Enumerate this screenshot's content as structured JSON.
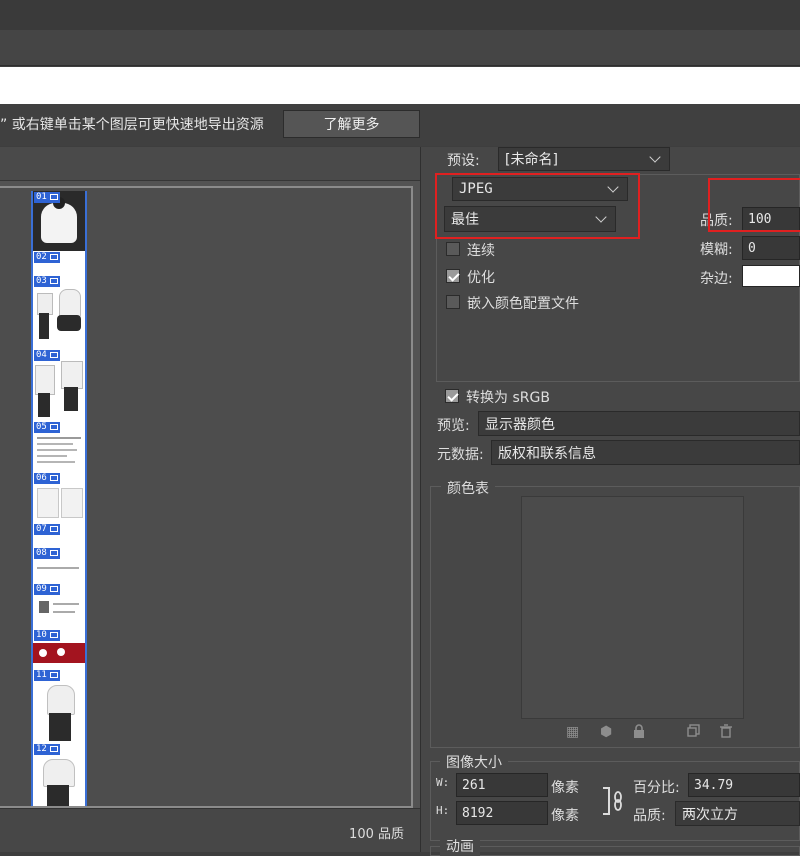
{
  "notice": {
    "hint_text": "” 或右键单击某个图层可更快速地导出资源",
    "learn_more": "了解更多"
  },
  "slices": [
    {
      "num": "01"
    },
    {
      "num": "02"
    },
    {
      "num": "03"
    },
    {
      "num": "04"
    },
    {
      "num": "05"
    },
    {
      "num": "06"
    },
    {
      "num": "07"
    },
    {
      "num": "08"
    },
    {
      "num": "09"
    },
    {
      "num": "10"
    },
    {
      "num": "11"
    },
    {
      "num": "12"
    }
  ],
  "status": {
    "quality": "100 品质"
  },
  "settings": {
    "preset_label": "预设:",
    "preset_value": "[未命名]",
    "format": "JPEG",
    "quality_level": "最佳",
    "quality_label": "品质:",
    "quality_value": "100",
    "blur_label": "模糊:",
    "blur_value": "0",
    "matte_label": "杂边:",
    "progressive_label": "连续",
    "progressive_checked": false,
    "optimize_label": "优化",
    "optimize_checked": true,
    "embed_profile_label": "嵌入颜色配置文件",
    "embed_profile_checked": false,
    "convert_srgb_label": "转换为 sRGB",
    "convert_srgb_checked": true,
    "preview_label": "预览:",
    "preview_value": "显示器颜色",
    "metadata_label": "元数据:",
    "metadata_value": "版权和联系信息",
    "color_table_label": "颜色表"
  },
  "image_size": {
    "title": "图像大小",
    "w_label": "W:",
    "w_value": "261",
    "h_label": "H:",
    "h_value": "8192",
    "unit": "像素",
    "percent_label": "百分比:",
    "percent_value": "34.79",
    "quality_label": "品质:",
    "resample_value": "两次立方"
  },
  "animation": {
    "title": "动画"
  },
  "colors": {
    "accent_blue": "#2e63d4",
    "highlight_red": "#e02020"
  },
  "icons": [
    "checker-icon",
    "cube-icon",
    "lock-icon",
    "new-color-icon",
    "trash-icon",
    "link-icon"
  ]
}
